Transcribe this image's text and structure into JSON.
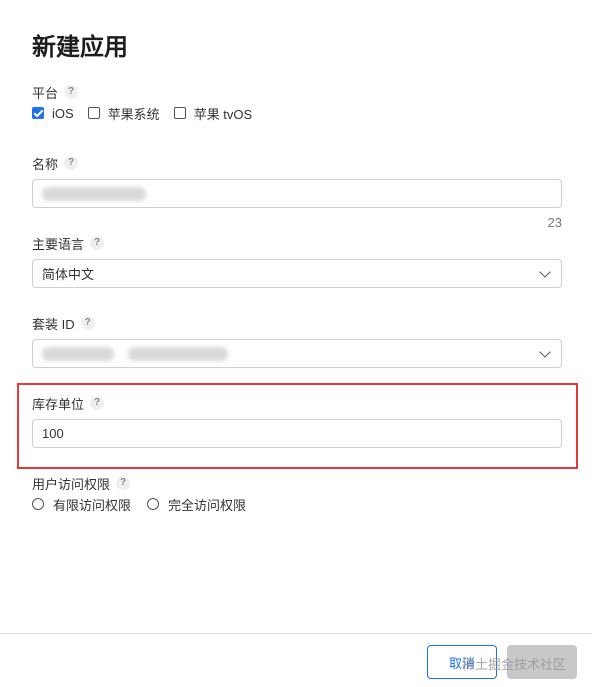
{
  "title": "新建应用",
  "help_symbol": "?",
  "platform": {
    "label": "平台",
    "options": [
      {
        "label": "iOS",
        "checked": true
      },
      {
        "label": "苹果系统",
        "checked": false
      },
      {
        "label": "苹果 tvOS",
        "checked": false
      }
    ]
  },
  "name_field": {
    "label": "名称",
    "counter": "23"
  },
  "language": {
    "label": "主要语言",
    "value": "简体中文"
  },
  "bundle": {
    "label": "套装 ID"
  },
  "sku": {
    "label": "库存单位",
    "value": "100"
  },
  "access": {
    "label": "用户访问权限",
    "options": [
      {
        "label": "有限访问权限"
      },
      {
        "label": "完全访问权限"
      }
    ]
  },
  "footer": {
    "cancel_label": "取消",
    "watermark": "稀土掘金技术社区"
  },
  "colors": {
    "accent": "#1a73e8",
    "highlight_border": "#e23b3b",
    "disabled_button": "#c8c8c8"
  }
}
